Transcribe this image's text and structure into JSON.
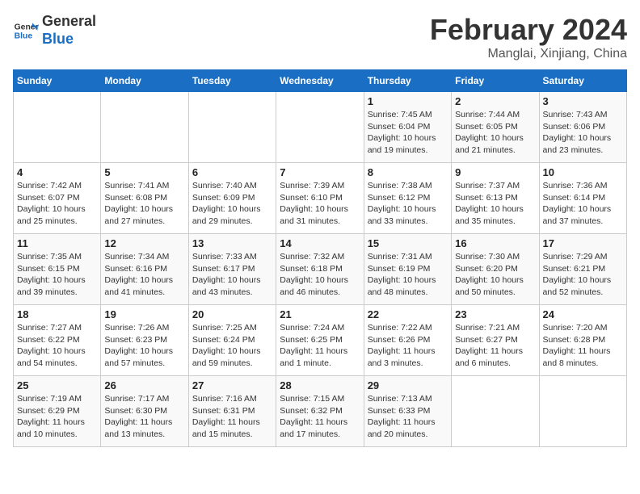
{
  "logo": {
    "line1": "General",
    "line2": "Blue"
  },
  "title": "February 2024",
  "subtitle": "Manglai, Xinjiang, China",
  "weekdays": [
    "Sunday",
    "Monday",
    "Tuesday",
    "Wednesday",
    "Thursday",
    "Friday",
    "Saturday"
  ],
  "weeks": [
    [
      {
        "day": "",
        "info": ""
      },
      {
        "day": "",
        "info": ""
      },
      {
        "day": "",
        "info": ""
      },
      {
        "day": "",
        "info": ""
      },
      {
        "day": "1",
        "info": "Sunrise: 7:45 AM\nSunset: 6:04 PM\nDaylight: 10 hours\nand 19 minutes."
      },
      {
        "day": "2",
        "info": "Sunrise: 7:44 AM\nSunset: 6:05 PM\nDaylight: 10 hours\nand 21 minutes."
      },
      {
        "day": "3",
        "info": "Sunrise: 7:43 AM\nSunset: 6:06 PM\nDaylight: 10 hours\nand 23 minutes."
      }
    ],
    [
      {
        "day": "4",
        "info": "Sunrise: 7:42 AM\nSunset: 6:07 PM\nDaylight: 10 hours\nand 25 minutes."
      },
      {
        "day": "5",
        "info": "Sunrise: 7:41 AM\nSunset: 6:08 PM\nDaylight: 10 hours\nand 27 minutes."
      },
      {
        "day": "6",
        "info": "Sunrise: 7:40 AM\nSunset: 6:09 PM\nDaylight: 10 hours\nand 29 minutes."
      },
      {
        "day": "7",
        "info": "Sunrise: 7:39 AM\nSunset: 6:10 PM\nDaylight: 10 hours\nand 31 minutes."
      },
      {
        "day": "8",
        "info": "Sunrise: 7:38 AM\nSunset: 6:12 PM\nDaylight: 10 hours\nand 33 minutes."
      },
      {
        "day": "9",
        "info": "Sunrise: 7:37 AM\nSunset: 6:13 PM\nDaylight: 10 hours\nand 35 minutes."
      },
      {
        "day": "10",
        "info": "Sunrise: 7:36 AM\nSunset: 6:14 PM\nDaylight: 10 hours\nand 37 minutes."
      }
    ],
    [
      {
        "day": "11",
        "info": "Sunrise: 7:35 AM\nSunset: 6:15 PM\nDaylight: 10 hours\nand 39 minutes."
      },
      {
        "day": "12",
        "info": "Sunrise: 7:34 AM\nSunset: 6:16 PM\nDaylight: 10 hours\nand 41 minutes."
      },
      {
        "day": "13",
        "info": "Sunrise: 7:33 AM\nSunset: 6:17 PM\nDaylight: 10 hours\nand 43 minutes."
      },
      {
        "day": "14",
        "info": "Sunrise: 7:32 AM\nSunset: 6:18 PM\nDaylight: 10 hours\nand 46 minutes."
      },
      {
        "day": "15",
        "info": "Sunrise: 7:31 AM\nSunset: 6:19 PM\nDaylight: 10 hours\nand 48 minutes."
      },
      {
        "day": "16",
        "info": "Sunrise: 7:30 AM\nSunset: 6:20 PM\nDaylight: 10 hours\nand 50 minutes."
      },
      {
        "day": "17",
        "info": "Sunrise: 7:29 AM\nSunset: 6:21 PM\nDaylight: 10 hours\nand 52 minutes."
      }
    ],
    [
      {
        "day": "18",
        "info": "Sunrise: 7:27 AM\nSunset: 6:22 PM\nDaylight: 10 hours\nand 54 minutes."
      },
      {
        "day": "19",
        "info": "Sunrise: 7:26 AM\nSunset: 6:23 PM\nDaylight: 10 hours\nand 57 minutes."
      },
      {
        "day": "20",
        "info": "Sunrise: 7:25 AM\nSunset: 6:24 PM\nDaylight: 10 hours\nand 59 minutes."
      },
      {
        "day": "21",
        "info": "Sunrise: 7:24 AM\nSunset: 6:25 PM\nDaylight: 11 hours\nand 1 minute."
      },
      {
        "day": "22",
        "info": "Sunrise: 7:22 AM\nSunset: 6:26 PM\nDaylight: 11 hours\nand 3 minutes."
      },
      {
        "day": "23",
        "info": "Sunrise: 7:21 AM\nSunset: 6:27 PM\nDaylight: 11 hours\nand 6 minutes."
      },
      {
        "day": "24",
        "info": "Sunrise: 7:20 AM\nSunset: 6:28 PM\nDaylight: 11 hours\nand 8 minutes."
      }
    ],
    [
      {
        "day": "25",
        "info": "Sunrise: 7:19 AM\nSunset: 6:29 PM\nDaylight: 11 hours\nand 10 minutes."
      },
      {
        "day": "26",
        "info": "Sunrise: 7:17 AM\nSunset: 6:30 PM\nDaylight: 11 hours\nand 13 minutes."
      },
      {
        "day": "27",
        "info": "Sunrise: 7:16 AM\nSunset: 6:31 PM\nDaylight: 11 hours\nand 15 minutes."
      },
      {
        "day": "28",
        "info": "Sunrise: 7:15 AM\nSunset: 6:32 PM\nDaylight: 11 hours\nand 17 minutes."
      },
      {
        "day": "29",
        "info": "Sunrise: 7:13 AM\nSunset: 6:33 PM\nDaylight: 11 hours\nand 20 minutes."
      },
      {
        "day": "",
        "info": ""
      },
      {
        "day": "",
        "info": ""
      }
    ]
  ]
}
